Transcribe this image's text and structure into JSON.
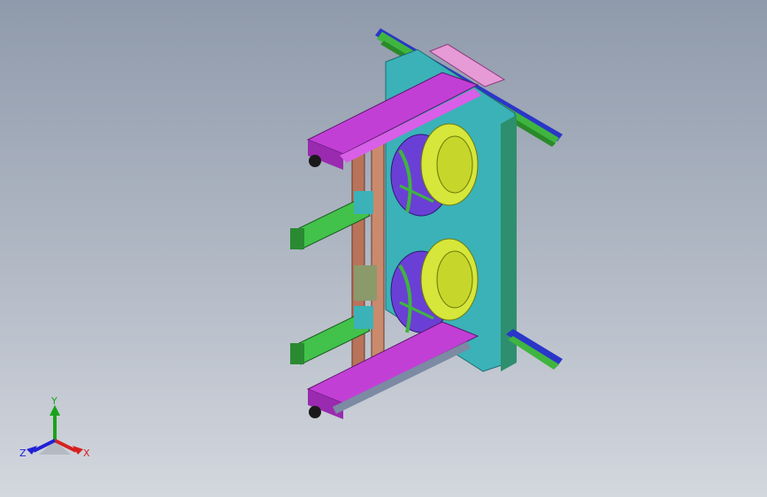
{
  "viewport": {
    "background_top": "#8f9aab",
    "background_bottom": "#d3d7de"
  },
  "model": {
    "icon": "3d-assembly-model",
    "parts": {
      "top_rail": "#3fb53f",
      "side_rail": "#2a36c8",
      "frame_magenta": "#c23fd6",
      "pink_bracket": "#e69ad6",
      "back_plate": "#3ab2b8",
      "copper_column": "#b8735a",
      "cylinder_body": "#42c24a",
      "drum_face": "#d6e63a",
      "drum_rim": "#6a3fd6",
      "grey_channel": "#7c8aa3"
    }
  },
  "triad": {
    "icon": "coordinate-triad-icon",
    "x_label": "X",
    "y_label": "Y",
    "z_label": "Z",
    "x_color": "#d62020",
    "y_color": "#1aa31a",
    "z_color": "#2020d6"
  }
}
